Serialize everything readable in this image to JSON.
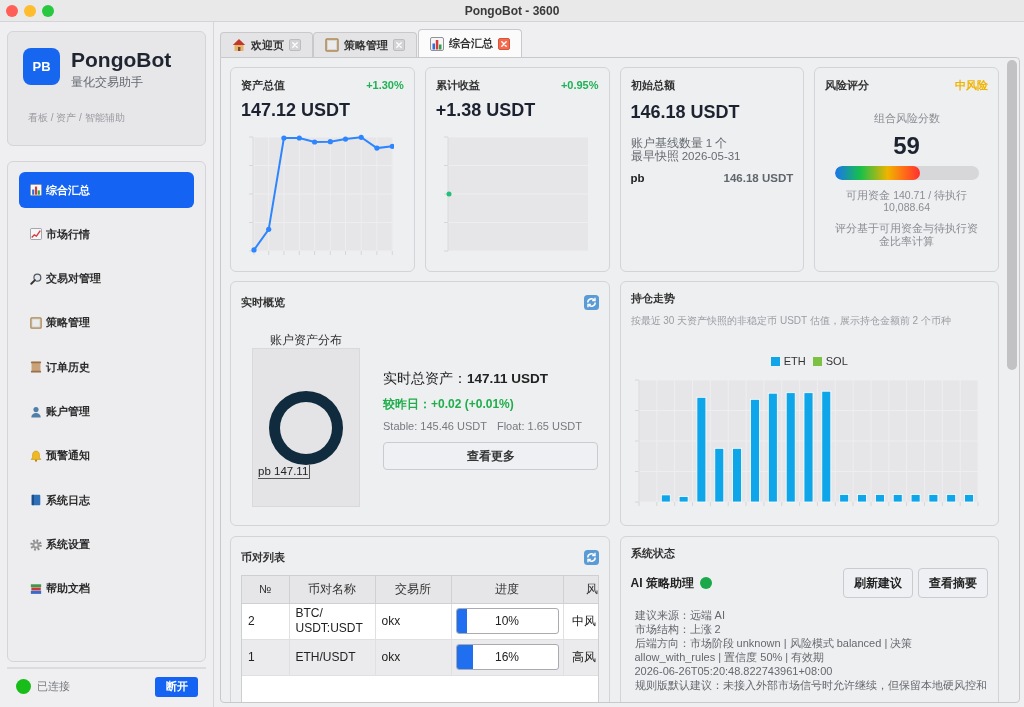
{
  "window": {
    "title": "PongoBot - 3600"
  },
  "sidebar": {
    "brand": {
      "logo": "PB",
      "name": "PongoBot",
      "subtitle": "量化交易助手",
      "tagline": "看板 / 资产 / 智能辅助"
    },
    "items": [
      {
        "label": "综合汇总",
        "selected": true
      },
      {
        "label": "市场行情",
        "selected": false
      },
      {
        "label": "交易对管理",
        "selected": false
      },
      {
        "label": "策略管理",
        "selected": false
      },
      {
        "label": "订单历史",
        "selected": false
      },
      {
        "label": "账户管理",
        "selected": false
      },
      {
        "label": "预警通知",
        "selected": false
      },
      {
        "label": "系统日志",
        "selected": false
      },
      {
        "label": "系统设置",
        "selected": false
      },
      {
        "label": "帮助文档",
        "selected": false
      }
    ],
    "connection": {
      "status": "已连接",
      "connected": true,
      "button": "断开"
    }
  },
  "tabs": [
    {
      "label": "欢迎页",
      "selected": false
    },
    {
      "label": "策略管理",
      "selected": false
    },
    {
      "label": "综合汇总",
      "selected": true
    }
  ],
  "summary": {
    "asset_value": {
      "title": "资产总值",
      "change": "+1.30%",
      "value": "147.12 USDT"
    },
    "cumulative_return": {
      "title": "累计收益",
      "change": "+0.95%",
      "value": "+1.38 USDT"
    },
    "initial_total": {
      "title": "初始总额",
      "value": "146.18 USDT",
      "notes": [
        "账户基线数量 1 个",
        "最早快照 2026-05-31"
      ],
      "accounts": [
        {
          "name": "pb",
          "amount": "146.18 USDT"
        }
      ]
    },
    "risk_score": {
      "title": "风险评分",
      "badge": "中风险",
      "caption": "组合风险分数",
      "score": "59",
      "level": 0.59,
      "funds": "可用资金 140.71 / 待执行 10,088.64",
      "note": "评分基于可用资金与待执行资金比率计算"
    }
  },
  "realtime_overview": {
    "title": "实时概览",
    "distribution": {
      "title": "账户资产分布",
      "label": "pb 147.11"
    },
    "total": "实时总资产：**147.11 USDT**",
    "change": "较昨日：+0.02 (+0.01%)",
    "stable": "Stable: 145.46 USDT",
    "float": "Float: 1.65 USDT",
    "button": "查看更多"
  },
  "holdings_trend": {
    "title": "持仓走势",
    "subtitle": "按最近 30 天资产快照的非稳定币 USDT 估值，展示持仓金额前 2 个币种",
    "legend": [
      {
        "name": "ETH",
        "color": "#0ea5e9"
      },
      {
        "name": "SOL",
        "color": "#7cc142"
      }
    ]
  },
  "pair_list": {
    "title": "币对列表",
    "columns": [
      "№",
      "币对名称",
      "交易所",
      "进度",
      "风"
    ],
    "rows": [
      {
        "no": "2",
        "pair": "BTC/USDT:USDT",
        "exchange": "okx",
        "level": 0.1,
        "progress": "10%",
        "risk": "中风"
      },
      {
        "no": "1",
        "pair": "ETH/USDT",
        "exchange": "okx",
        "level": 0.16,
        "progress": "16%",
        "risk": "高风"
      }
    ]
  },
  "system_status": {
    "title": "系统状态",
    "assistant": {
      "name": "AI 策略助理",
      "online": true
    },
    "buttons": [
      "刷新建议",
      "查看摘要"
    ],
    "lines": [
      "建议来源：远端 AI",
      "市场结构：上涨 2",
      "后端方向：市场阶段 unknown | 风险模式 balanced | 决策 allow_with_rules | 置信度 50% | 有效期 2026-06-26T05:20:48.822743961+08:00",
      "规则版默认建议：未接入外部市场信号时允许继续，但保留本地硬风控和"
    ]
  }
}
